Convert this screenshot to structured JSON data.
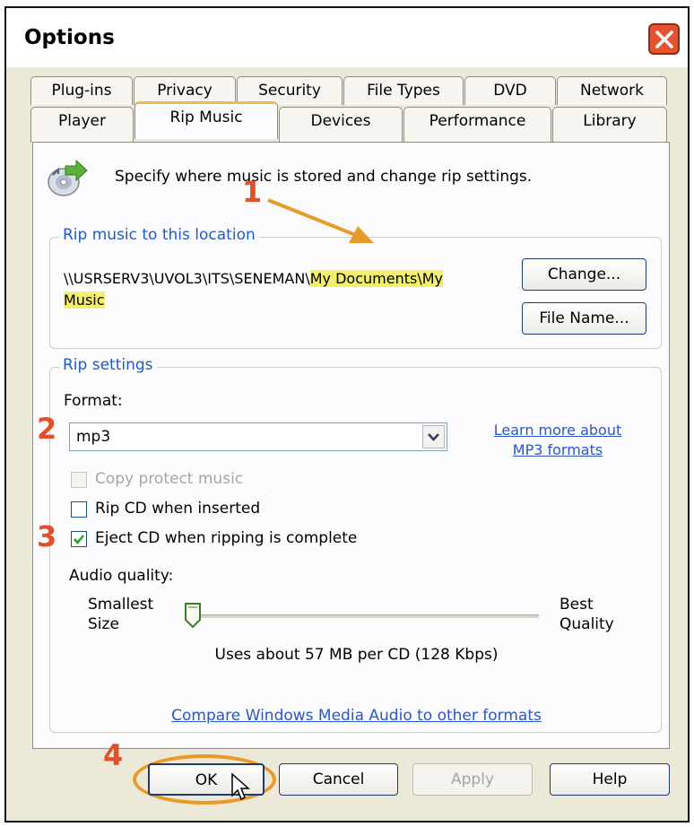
{
  "window": {
    "title": "Options",
    "close_icon": "close-icon"
  },
  "tabs_row1": [
    "Plug-ins",
    "Privacy",
    "Security",
    "File Types",
    "DVD",
    "Network"
  ],
  "tabs_row2": [
    "Player",
    "Rip Music",
    "Devices",
    "Performance",
    "Library"
  ],
  "active_tab": "Rip Music",
  "intro": {
    "icon": "cd-arrow-icon",
    "text": "Specify where music is stored and change rip settings."
  },
  "rip_location": {
    "legend": "Rip music to this location",
    "path_prefix": "\\\\USRSERV3\\UVOL3\\ITS\\SENEMAN\\",
    "path_highlight_1": "My Documents\\My",
    "path_highlight_2": "Music",
    "change_label": "Change...",
    "filename_label": "File Name..."
  },
  "rip_settings": {
    "legend": "Rip settings",
    "format_label": "Format:",
    "format_value": "mp3",
    "learn_more_1": "Learn more about",
    "learn_more_2": "MP3 formats",
    "copy_protect_label": "Copy protect music",
    "copy_protect_checked": false,
    "rip_when_inserted_label": "Rip CD when inserted",
    "rip_when_inserted_checked": false,
    "eject_label": "Eject CD when ripping is complete",
    "eject_checked": true,
    "audio_quality_label": "Audio quality:",
    "smallest_1": "Smallest",
    "smallest_2": "Size",
    "best_1": "Best",
    "best_2": "Quality",
    "quality_level": 0,
    "usage_text": "Uses about 57 MB per CD (128 Kbps)",
    "compare_link": "Compare Windows Media Audio to other formats"
  },
  "footer": {
    "ok_label": "OK",
    "cancel_label": "Cancel",
    "apply_label": "Apply",
    "help_label": "Help"
  },
  "annotations": {
    "n1": "1",
    "n2": "2",
    "n3": "3",
    "n4": "4",
    "accent": "#e2502a"
  }
}
